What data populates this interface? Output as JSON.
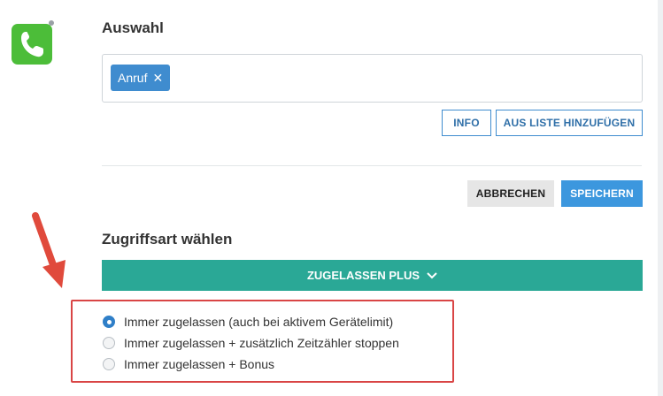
{
  "app": {
    "icon": "phone-icon",
    "icon_color": "#4cbd39"
  },
  "selection": {
    "title": "Auswahl",
    "chips": [
      {
        "label": "Anruf",
        "remove_icon": "close-icon"
      }
    ],
    "buttons": {
      "info": "INFO",
      "add_from_list": "AUS LISTE HINZUFÜGEN"
    }
  },
  "form_actions": {
    "cancel": "ABBRECHEN",
    "save": "SPEICHERN"
  },
  "access": {
    "title": "Zugriffsart wählen",
    "dropdown_label": "ZUGELASSEN PLUS",
    "dropdown_icon": "chevron-down-icon",
    "dropdown_color": "#2aa896",
    "options": [
      {
        "label": "Immer zugelassen (auch bei aktivem Gerätelimit)",
        "checked": true
      },
      {
        "label": "Immer zugelassen + zusätzlich Zeitzähler stoppen",
        "checked": false
      },
      {
        "label": "Immer zugelassen + Bonus",
        "checked": false
      }
    ]
  },
  "annotations": {
    "arrow_icon": "red-arrow-icon",
    "highlight_color": "#d94545"
  }
}
